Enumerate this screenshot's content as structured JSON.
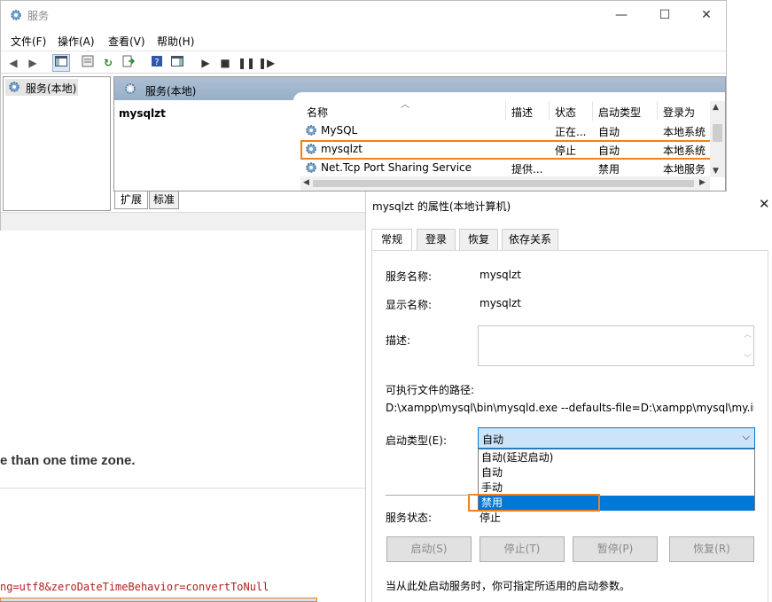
{
  "window": {
    "title": "服务",
    "min": "—",
    "max": "☐",
    "close": "✕"
  },
  "menu": [
    "文件(F)",
    "操作(A)",
    "查看(V)",
    "帮助(H)"
  ],
  "tree": {
    "root": "服务(本地)"
  },
  "header": {
    "title": "服务(本地)"
  },
  "selected_service": "mysqlzt",
  "list": {
    "columns": [
      "名称",
      "描述",
      "状态",
      "启动类型",
      "登录为"
    ],
    "rows": [
      {
        "name": "MySQL",
        "desc": "",
        "status": "正在...",
        "startup": "自动",
        "logon": "本地系统"
      },
      {
        "name": "mysqlzt",
        "desc": "",
        "status": "停止",
        "startup": "自动",
        "logon": "本地系统"
      },
      {
        "name": "Net.Tcp Port Sharing Service",
        "desc": "提供...",
        "status": "",
        "startup": "禁用",
        "logon": "本地服务"
      }
    ]
  },
  "bottom_tabs": [
    "扩展",
    "标准"
  ],
  "dialog": {
    "title": "mysqlzt 的属性(本地计算机)",
    "tabs": [
      "常规",
      "登录",
      "恢复",
      "依存关系"
    ],
    "service_name_label": "服务名称:",
    "service_name": "mysqlzt",
    "display_name_label": "显示名称:",
    "display_name": "mysqlzt",
    "description_label": "描述:",
    "path_label": "可执行文件的路径:",
    "path": "D:\\xampp\\mysql\\bin\\mysqld.exe --defaults-file=D:\\xampp\\mysql\\my.ini",
    "startup_label": "启动类型(E):",
    "startup_value": "自动",
    "startup_options": [
      "自动(延迟启动)",
      "自动",
      "手动",
      "禁用"
    ],
    "status_label": "服务状态:",
    "status_value": "停止",
    "buttons": [
      "启动(S)",
      "停止(T)",
      "暂停(P)",
      "恢复(R)"
    ],
    "hint": "当从此处启动服务时，你可指定所适用的启动参数。"
  },
  "background": {
    "text": "e than one time zone.",
    "code": "ng=utf8&zeroDateTimeBehavior=convertToNull"
  },
  "colors": {
    "highlight": "#0078d7",
    "orange": "#f08020",
    "combo_bg": "#cce4f7"
  }
}
